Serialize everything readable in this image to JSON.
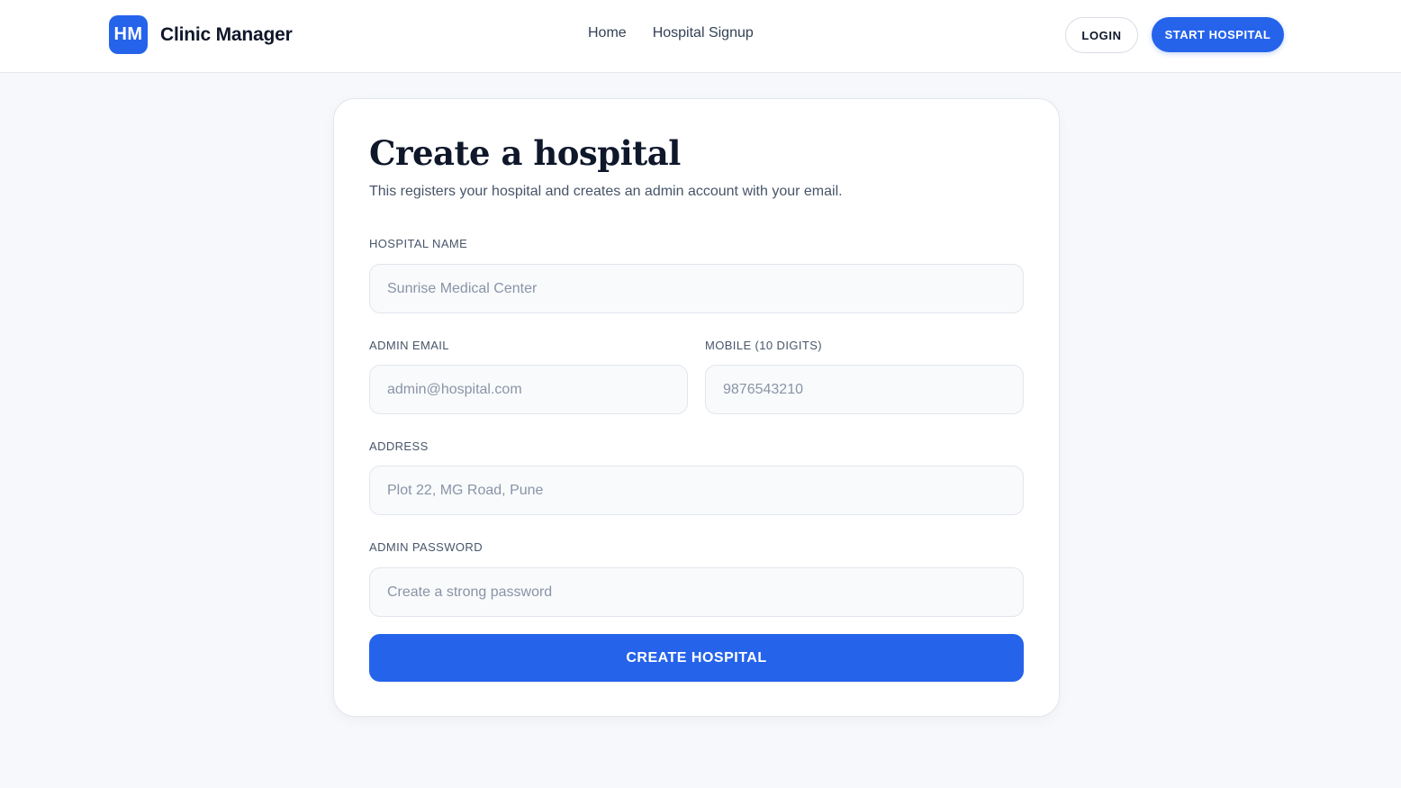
{
  "brand": {
    "logo_text": "HM",
    "name": "Clinic Manager"
  },
  "nav": {
    "links": [
      {
        "label": "Home"
      },
      {
        "label": "Hospital Signup"
      }
    ],
    "login_label": "LOGIN",
    "start_label": "START HOSPITAL"
  },
  "form": {
    "title": "Create a hospital",
    "subtitle": "This registers your hospital and creates an admin account with your email.",
    "hospital_name": {
      "label": "HOSPITAL NAME",
      "placeholder": "Sunrise Medical Center",
      "value": ""
    },
    "admin_email": {
      "label": "ADMIN EMAIL",
      "placeholder": "admin@hospital.com",
      "value": ""
    },
    "mobile": {
      "label": "MOBILE (10 DIGITS)",
      "placeholder": "9876543210",
      "value": ""
    },
    "address": {
      "label": "ADDRESS",
      "placeholder": "Plot 22, MG Road, Pune",
      "value": ""
    },
    "admin_password": {
      "label": "ADMIN PASSWORD",
      "placeholder": "Create a strong password",
      "value": ""
    },
    "submit_label": "CREATE HOSPITAL"
  },
  "colors": {
    "accent": "#2563eb",
    "background": "#f7f8fb",
    "text": "#0f172a",
    "muted": "#475569"
  }
}
